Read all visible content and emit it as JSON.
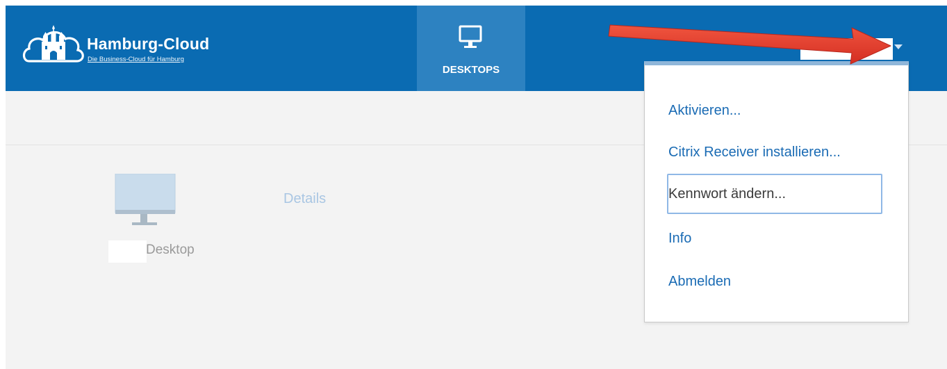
{
  "header": {
    "brand_name": "Hamburg-Cloud",
    "brand_tagline": "Die Business-Cloud für Hamburg",
    "tabs": [
      {
        "label": "DESKTOPS",
        "icon": "monitor-icon",
        "active": true
      }
    ],
    "user_menu_icon": "caret-down-icon"
  },
  "main": {
    "desktop": {
      "icon": "monitor-icon",
      "name": "Desktop"
    },
    "details_label": "Details"
  },
  "user_menu": {
    "items": [
      {
        "label": "Aktivieren..."
      },
      {
        "label": "Citrix Receiver installieren..."
      },
      {
        "label": "Kennwort ändern...",
        "focused": true
      },
      {
        "label": "Info"
      },
      {
        "label": "Abmelden"
      }
    ]
  },
  "colors": {
    "header_bg": "#0a6bb2",
    "active_tab_bg": "#2d82c1",
    "page_bg": "#f3f3f3",
    "menu_text": "#1a6bb4",
    "annotation_arrow": "#e53b2f"
  }
}
